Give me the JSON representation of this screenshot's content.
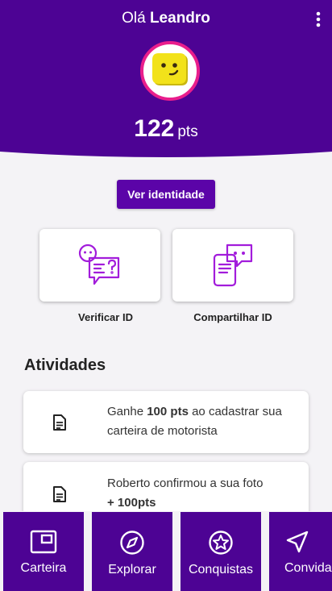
{
  "header": {
    "greeting_prefix": "Olá",
    "user_name": "Leandro",
    "points_value": "122",
    "points_unit": "pts",
    "menu_icon": "more-vertical-icon",
    "avatar_icon": "smiley-face-icon"
  },
  "actions": {
    "verify_identity_label": "Ver identidade",
    "cards": [
      {
        "label": "Verificar ID",
        "icon": "chat-question-icon"
      },
      {
        "label": "Compartilhar ID",
        "icon": "phone-chat-icon"
      }
    ]
  },
  "activities": {
    "title": "Atividades",
    "items": [
      {
        "text_before": "Ganhe ",
        "bold": "100 pts",
        "text_after": " ao cadastrar sua carteira de motorista",
        "icon": "document-icon"
      },
      {
        "text_before": "Roberto confirmou a sua foto",
        "bold": "+ 100pts",
        "text_after": "",
        "icon": "document-icon"
      }
    ]
  },
  "nav": {
    "items": [
      {
        "label": "Carteira",
        "icon": "wallet-icon"
      },
      {
        "label": "Explorar",
        "icon": "compass-icon"
      },
      {
        "label": "Conquistas",
        "icon": "star-badge-icon"
      },
      {
        "label": "Convidar",
        "icon": "send-icon"
      }
    ]
  },
  "colors": {
    "primary": "#4d0394",
    "button": "#5b04a8",
    "avatar_ring": "#e91e8c",
    "avatar_face": "#f2e21a",
    "icon_purple": "#a21cdb"
  }
}
